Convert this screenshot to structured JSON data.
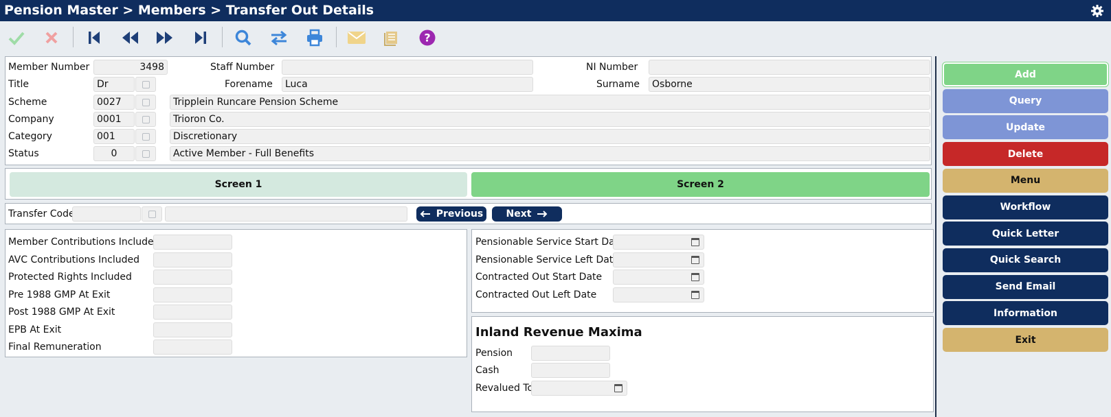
{
  "titlebar": {
    "title": "Pension Master > Members > Transfer Out Details",
    "settings_icon": "gear-icon"
  },
  "toolbar": {
    "icons": [
      "check-icon",
      "cancel-icon",
      "first-record-icon",
      "previous-record-icon",
      "next-record-icon",
      "last-record-icon",
      "search-icon",
      "swap-icon",
      "print-icon",
      "email-icon",
      "notebook-icon",
      "help-icon"
    ]
  },
  "member": {
    "member_number_label": "Member Number",
    "member_number": "3498",
    "staff_number_label": "Staff Number",
    "staff_number": "",
    "ni_number_label": "NI Number",
    "ni_number": "",
    "title_label": "Title",
    "title": "Dr",
    "forename_label": "Forename",
    "forename": "Luca",
    "surname_label": "Surname",
    "surname": "Osborne",
    "scheme_label": "Scheme",
    "scheme_code": "0027",
    "scheme_name": "Tripplein Runcare Pension Scheme",
    "company_label": "Company",
    "company_code": "0001",
    "company_name": "Trioron Co.",
    "category_label": "Category",
    "category_code": "001",
    "category_name": "Discretionary",
    "status_label": "Status",
    "status_code": "0",
    "status_name": "Active Member - Full Benefits"
  },
  "screens": {
    "screen1": "Screen 1",
    "screen2": "Screen 2",
    "active": "screen2"
  },
  "transfer": {
    "code_label": "Transfer Code",
    "code": "",
    "description": "",
    "previous_label": "Previous",
    "next_label": "Next"
  },
  "left_fields": [
    {
      "label": "Member Contributions Included",
      "value": ""
    },
    {
      "label": "AVC Contributions Included",
      "value": ""
    },
    {
      "label": "Protected Rights Included",
      "value": ""
    },
    {
      "label": "Pre 1988 GMP At Exit",
      "value": ""
    },
    {
      "label": "Post 1988 GMP At Exit",
      "value": ""
    },
    {
      "label": "EPB At Exit",
      "value": ""
    },
    {
      "label": "Final Remuneration",
      "value": ""
    }
  ],
  "right_fields": [
    {
      "label": "Pensionable Service Start Date",
      "value": ""
    },
    {
      "label": "Pensionable Service Left Date",
      "value": ""
    },
    {
      "label": "Contracted Out Start Date",
      "value": ""
    },
    {
      "label": "Contracted Out Left Date",
      "value": ""
    }
  ],
  "maxima": {
    "heading": "Inland Revenue Maxima",
    "pension_label": "Pension",
    "pension": "",
    "cash_label": "Cash",
    "cash": "",
    "revalued_label": "Revalued To",
    "revalued": ""
  },
  "sidebar": {
    "buttons": [
      {
        "label": "Add",
        "color": "#7fd487",
        "text": "#ffffff"
      },
      {
        "label": "Query",
        "color": "#7e95d6",
        "text": "#ffffff"
      },
      {
        "label": "Update",
        "color": "#7e95d6",
        "text": "#ffffff"
      },
      {
        "label": "Delete",
        "color": "#c62828",
        "text": "#ffffff"
      },
      {
        "label": "Menu",
        "color": "#d4b46e",
        "text": "#111111"
      },
      {
        "label": "Workflow",
        "color": "#0f2d5e",
        "text": "#ffffff"
      },
      {
        "label": "Quick Letter",
        "color": "#0f2d5e",
        "text": "#ffffff"
      },
      {
        "label": "Quick Search",
        "color": "#0f2d5e",
        "text": "#ffffff"
      },
      {
        "label": "Send Email",
        "color": "#0f2d5e",
        "text": "#ffffff"
      },
      {
        "label": "Information",
        "color": "#0f2d5e",
        "text": "#ffffff"
      },
      {
        "label": "Exit",
        "color": "#d4b46e",
        "text": "#111111"
      }
    ]
  }
}
